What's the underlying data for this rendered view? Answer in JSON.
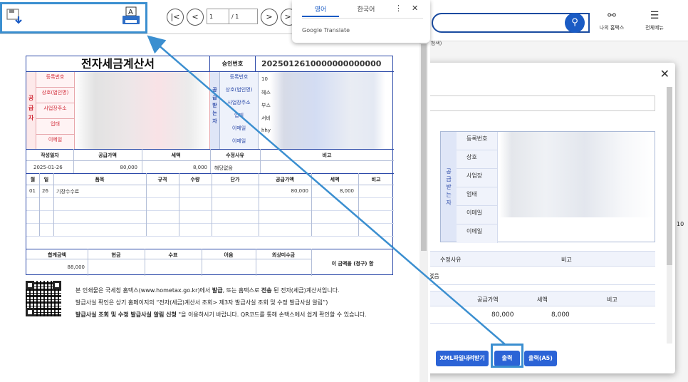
{
  "translate": {
    "tab_english": "영어",
    "tab_korean": "한국어",
    "brand": "Google Translate"
  },
  "viewer": {
    "page_current": "1",
    "page_total": "/ 1",
    "save_icon": "save-download-icon",
    "print_icon": "print-icon"
  },
  "invoice": {
    "title": "전자세금계산서",
    "approval_label": "승인번호",
    "approval_value": "2025012610000000000000",
    "supplier_side": "공급자",
    "supplier_labels": [
      "등록번호",
      "상호(법인명)",
      "사업장주소",
      "업태",
      "이메일"
    ],
    "receiver_side": "공급받는자",
    "receiver_labels": [
      "등록번호",
      "상호(법인명)",
      "사업장주소",
      "업태",
      "이메일",
      "이메일"
    ],
    "receiver_partial": [
      "10",
      "헤스",
      "부스",
      "서비",
      "hhy",
      ""
    ],
    "summary_headers": [
      "작성일자",
      "공급가액",
      "세액",
      "수정사유",
      "비고"
    ],
    "summary_values": [
      "2025-01-26",
      "80,000",
      "8,000",
      "해당없음",
      ""
    ],
    "item_headers": [
      "월",
      "일",
      "품목",
      "규격",
      "수량",
      "단가",
      "공급가액",
      "세액",
      "비고"
    ],
    "item_row": [
      "01",
      "26",
      "기장수수료",
      "",
      "",
      "",
      "80,000",
      "8,000",
      ""
    ],
    "total_headers": [
      "합계금액",
      "현금",
      "수표",
      "어음",
      "외상미수금"
    ],
    "total_value": "88,000",
    "claim_text": "이 금액을 (청구) 함"
  },
  "notice": {
    "line1_a": "본 인쇄물은 국세청 홈택스(www.hometax.go.kr)에서 ",
    "line1_b": "발급",
    "line1_c": ", 또는 홈택스로 ",
    "line1_d": "전송",
    "line1_e": " 된 전자(세금)계산서입니다.",
    "line2": "발급사실 확인은 상기 홈페이지의 “전자(세금)계산서 조회> 제3자 발급사실 조회 및 수정 발급사실 알림”)",
    "line3_a": "발급사실 조회 및 수정 발급사실 알림 신청",
    "line3_b": " \"을 이용하시기 바랍니다. QR코드를 통해 손택스에서 쉽게 확인할 수 있습니다."
  },
  "background": {
    "nav_my": "나의 홈택스",
    "nav_menu": "전체메뉴",
    "breadcrumb": "(청색)"
  },
  "modal": {
    "receiver_side": "공급받는자",
    "labels": [
      "등록번호",
      "상호",
      "사업장",
      "업태",
      "이메일",
      "이메일"
    ],
    "header1_a": "수정사유",
    "header1_b": "비고",
    "row1_a": "없음",
    "header2_b": "공급가액",
    "header2_c": "세액",
    "header2_d": "비고",
    "row2_b": "80,000",
    "row2_c": "8,000",
    "btn_xml": "XML파일내려받기",
    "btn_print": "출력",
    "btn_print_a5": "출력(A5)"
  },
  "side_number": "10"
}
